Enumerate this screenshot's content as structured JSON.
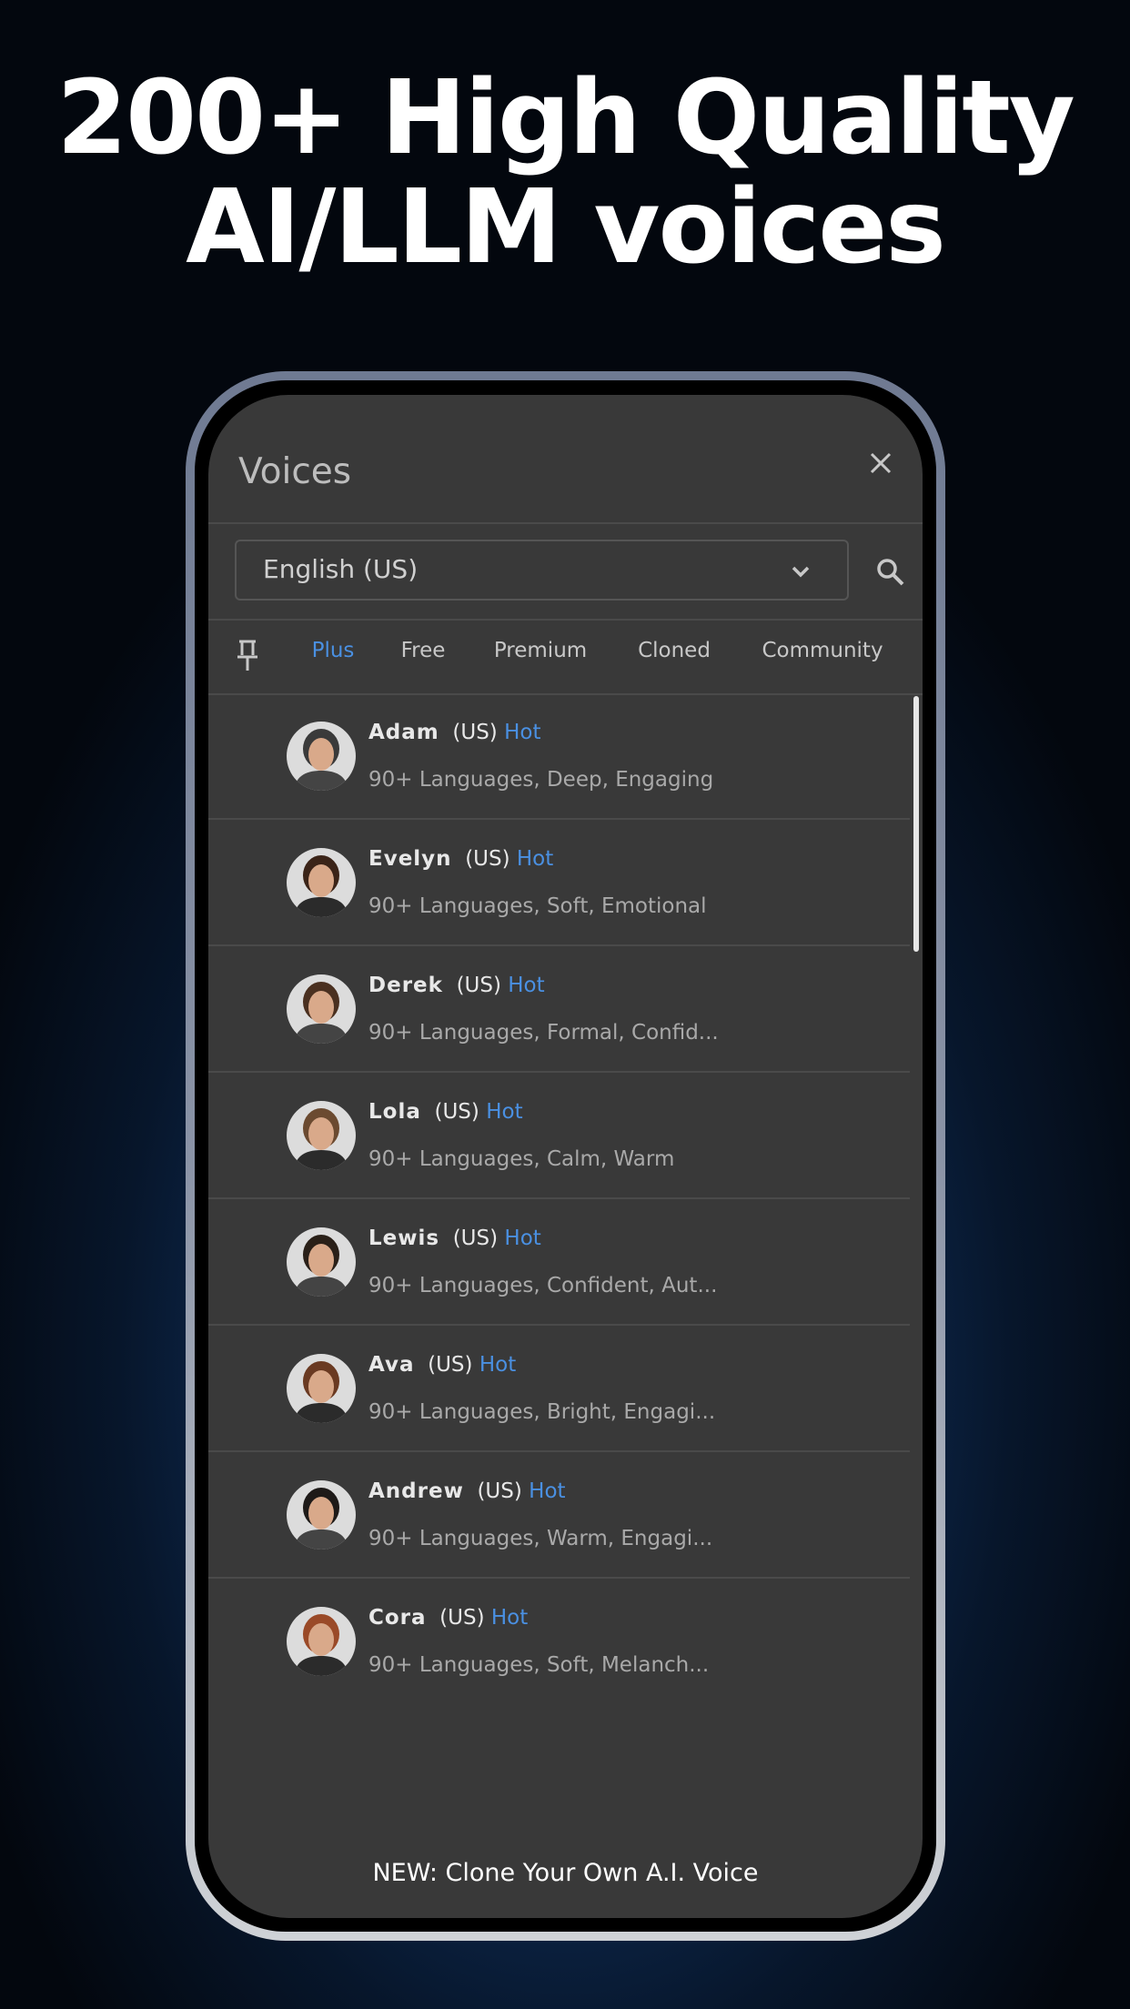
{
  "headline": {
    "line1": "200+ High Quality",
    "line2": "AI/LLM voices"
  },
  "dialog": {
    "title": "Voices",
    "close_icon": "close-icon",
    "language_select": {
      "value": "English (US)",
      "icon": "chevron-down-icon"
    },
    "search_icon": "search-icon",
    "pin_icon": "pin-icon",
    "tabs": [
      {
        "label": "Plus",
        "active": true
      },
      {
        "label": "Free",
        "active": false
      },
      {
        "label": "Premium",
        "active": false
      },
      {
        "label": "Cloned",
        "active": false
      },
      {
        "label": "Community",
        "active": false
      }
    ],
    "voices": [
      {
        "name": "Adam",
        "region": "(US)",
        "badge": "Hot",
        "desc": "90+ Languages, Deep, Engaging"
      },
      {
        "name": "Evelyn",
        "region": "(US)",
        "badge": "Hot",
        "desc": "90+ Languages, Soft, Emotional"
      },
      {
        "name": "Derek",
        "region": "(US)",
        "badge": "Hot",
        "desc": "90+ Languages, Formal, Confid..."
      },
      {
        "name": "Lola",
        "region": "(US)",
        "badge": "Hot",
        "desc": "90+ Languages, Calm, Warm"
      },
      {
        "name": "Lewis",
        "region": "(US)",
        "badge": "Hot",
        "desc": "90+ Languages, Confident, Aut..."
      },
      {
        "name": "Ava",
        "region": "(US)",
        "badge": "Hot",
        "desc": "90+ Languages, Bright, Engagi..."
      },
      {
        "name": "Andrew",
        "region": "(US)",
        "badge": "Hot",
        "desc": "90+ Languages, Warm, Engagi..."
      },
      {
        "name": "Cora",
        "region": "(US)",
        "badge": "Hot",
        "desc": "90+ Languages, Soft, Melanch..."
      }
    ],
    "footer_link": "NEW: Clone Your Own A.I. Voice"
  },
  "colors": {
    "accent": "#4a90e2",
    "panel": "#393939"
  }
}
